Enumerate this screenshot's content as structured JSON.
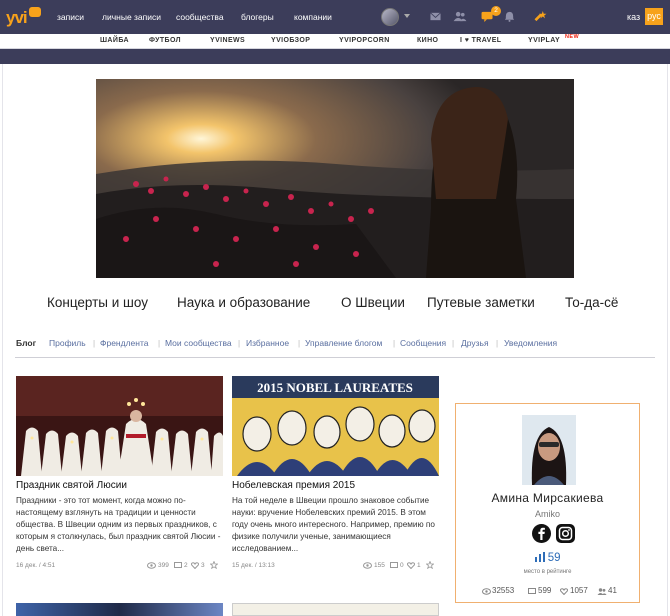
{
  "header": {
    "logo_text": "yvi",
    "nav": [
      "записи",
      "личные записи",
      "сообщества",
      "блогеры",
      "компании"
    ],
    "notifications_count": "2",
    "lang_kaz": "каз",
    "lang_rus": "рус"
  },
  "subnav": {
    "items": [
      "ШАЙБА",
      "ФУТБОЛ",
      "YVINEWS",
      "YVIОБЗОР",
      "YVIPOPCORN",
      "КИНО",
      "I ♥ TRAVEL",
      "YVIPLAY"
    ],
    "new_label": "NEW"
  },
  "blog": {
    "categories": [
      "Концерты и шоу",
      "Наука и образование",
      "О Швеции",
      "Путевые заметки",
      "То-да-сё"
    ],
    "tabs": [
      "Блог",
      "Профиль",
      "Френдлента",
      "Мои сообщества",
      "Избранное",
      "Управление блогом",
      "Сообщения",
      "Друзья",
      "Уведомления"
    ]
  },
  "posts": [
    {
      "title": "Праздник святой Люсии",
      "excerpt": "Праздники - это тот момент, когда можно по-настоящему взглянуть на традиции и ценности общества. В Швеции одним из первых праздников, с которым я столкнулась, был праздник святой Люсии - день света...",
      "date": "16 дек. / 4:51",
      "views": "399",
      "comments": "2",
      "likes": "3"
    },
    {
      "title": "Нобелевская премия 2015",
      "image_caption": "2015 NOBEL LAUREATES",
      "excerpt": "На той неделе в Швеции прошло знаковое событие науки: вручение Нобелевских премий 2015. В этом году очень много интересного. Например, премию по физике получили ученые, занимающиеся исследованием...",
      "date": "15 дек. / 13:13",
      "views": "155",
      "comments": "0",
      "likes": "1"
    }
  ],
  "profile": {
    "name": "Амина Мирсакиева",
    "nickname": "Amiko",
    "rating": "59",
    "rating_label": "место в рейтинге",
    "stats": {
      "views": "32553",
      "posts": "599",
      "likes": "1057",
      "friends": "41"
    }
  },
  "colors": {
    "accent": "#f7a21b",
    "header_bg": "#3c3d5a",
    "link": "#5a6fa0"
  }
}
